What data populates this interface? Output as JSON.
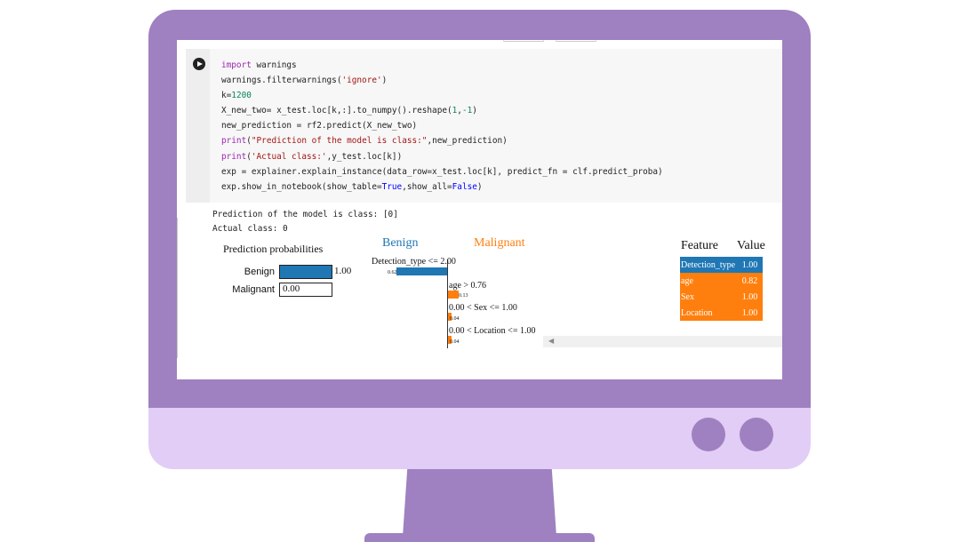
{
  "code_lines": [
    "import warnings",
    "warnings.filterwarnings('ignore')",
    "k=1200",
    "X_new_two= x_test.loc[k,:].to_numpy().reshape(1,-1)",
    "new_prediction = rf2.predict(X_new_two)",
    "print(\"Prediction of the model is class:\",new_prediction)",
    "print('Actual class:',y_test.loc[k])",
    "exp = explainer.explain_instance(data_row=x_test.loc[k], predict_fn = clf.predict_proba)",
    "exp.show_in_notebook(show_table=True,show_all=False)"
  ],
  "output": {
    "line1": "Prediction of the model is class: [0]",
    "line2": "Actual class: 0"
  },
  "prediction_probabilities": {
    "title": "Prediction probabilities",
    "items": [
      {
        "label": "Benign",
        "value": 1.0,
        "display": "1.00"
      },
      {
        "label": "Malignant",
        "value": 0.0,
        "display": "0.00"
      }
    ]
  },
  "explanation": {
    "class_left": "Benign",
    "class_right": "Malignant",
    "features": [
      {
        "label": "Detection_type <= 2.00",
        "weight": "0.62",
        "weight_value": 0.62,
        "side": "benign"
      },
      {
        "label": "age > 0.76",
        "weight": "0.13",
        "weight_value": 0.13,
        "side": "malignant"
      },
      {
        "label": "0.00 < Sex <= 1.00",
        "weight": "0.04",
        "weight_value": 0.04,
        "side": "malignant"
      },
      {
        "label": "0.00 < Location <= 1.00",
        "weight": "0.04",
        "weight_value": 0.04,
        "side": "malignant"
      }
    ]
  },
  "feature_table": {
    "header_feature": "Feature",
    "header_value": "Value",
    "rows": [
      {
        "feature": "Detection_type",
        "value": "1.00",
        "side": "benign"
      },
      {
        "feature": "age",
        "value": "0.82",
        "side": "malignant"
      },
      {
        "feature": "Sex",
        "value": "1.00",
        "side": "malignant"
      },
      {
        "feature": "Location",
        "value": "1.00",
        "side": "malignant"
      }
    ]
  },
  "colors": {
    "monitor_frame": "#9f80c0",
    "monitor_chin": "#e1cdf5",
    "benign": "#1f77b4",
    "malignant": "#ff7f0e"
  },
  "icons": {
    "run": "play-circle-icon"
  }
}
